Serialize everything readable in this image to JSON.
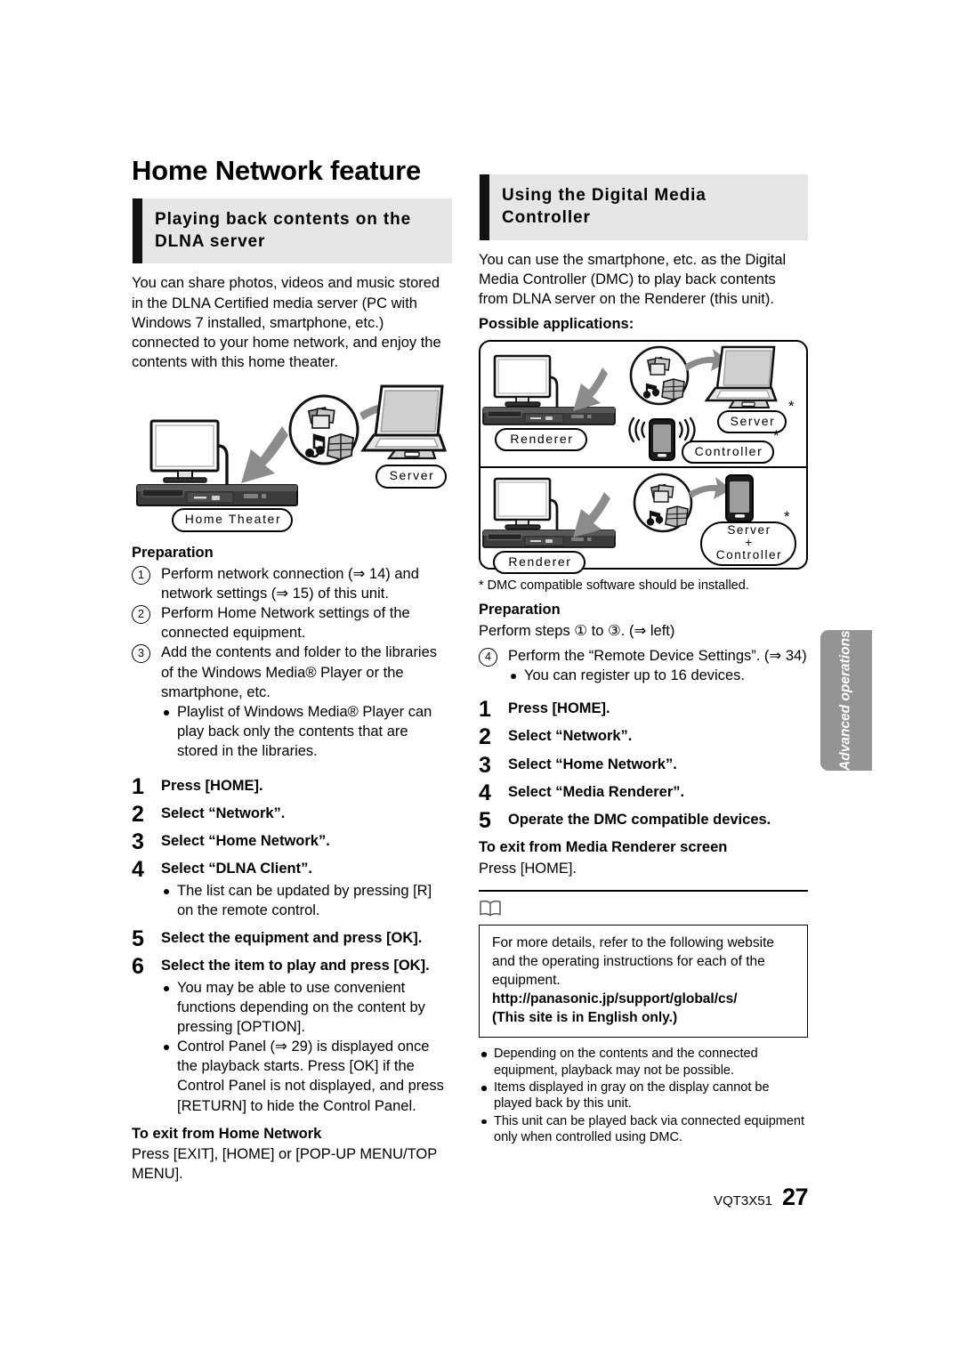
{
  "page": {
    "title": "Home Network feature",
    "footer_code": "VQT3X51",
    "footer_page": "27",
    "side_tab": "Advanced operations"
  },
  "left_column": {
    "section_title": "Playing back contents on the DLNA server",
    "intro": "You can share photos, videos and music stored in the DLNA Certified media server (PC with Windows 7 installed, smartphone, etc.) connected to your home network, and enjoy the contents with this home theater.",
    "figure": {
      "label_home_theater": "Home Theater",
      "label_server": "Server"
    },
    "preparation_heading": "Preparation",
    "preparation_items": [
      {
        "num": "1",
        "text": "Perform network connection (⇒ 14) and network settings (⇒ 15) of this unit."
      },
      {
        "num": "2",
        "text": "Perform Home Network settings of the connected equipment."
      },
      {
        "num": "3",
        "text": "Add the contents and folder to the libraries of the Windows Media® Player or the smartphone, etc."
      }
    ],
    "preparation_subnote": "Playlist of Windows Media® Player can play back only the contents that are stored in the libraries.",
    "steps": [
      {
        "num": "1",
        "text": "Press [HOME]."
      },
      {
        "num": "2",
        "text": "Select “Network”."
      },
      {
        "num": "3",
        "text": "Select “Home Network”."
      },
      {
        "num": "4",
        "text": "Select “DLNA Client”."
      },
      {
        "num": "5",
        "text": "Select the equipment and press [OK]."
      },
      {
        "num": "6",
        "text": "Select the item to play and press [OK]."
      }
    ],
    "step4_note": "The list can be updated by pressing [R] on the remote control.",
    "step6_notes": [
      "You may be able to use convenient functions depending on the content by pressing [OPTION].",
      "Control Panel (⇒ 29) is displayed once the playback starts. Press [OK] if the Control Panel is not displayed, and press [RETURN] to hide the Control Panel."
    ],
    "exit_heading": "To exit from Home Network",
    "exit_text": "Press [EXIT], [HOME] or [POP-UP MENU/TOP MENU]."
  },
  "right_column": {
    "section_title": "Using the Digital Media Controller",
    "intro": "You can use the smartphone, etc. as the Digital Media Controller (DMC) to play back contents from DLNA server on the Renderer (this unit).",
    "applications_heading": "Possible applications:",
    "figure": {
      "renderer_top": "Renderer",
      "renderer_bottom": "Renderer",
      "server": "Server",
      "controller": "Controller",
      "server_controller_line1": "Server",
      "server_controller_plus": "+",
      "server_controller_line2": "Controller",
      "star": "*"
    },
    "footnote": "*  DMC compatible software should be installed.",
    "preparation_heading": "Preparation",
    "preparation_lead": "Perform steps ① to ③. (⇒ left)",
    "preparation_items": [
      {
        "num": "4",
        "text": "Perform the “Remote Device Settings”. (⇒ 34)"
      }
    ],
    "preparation_subnote": "You can register up to 16 devices.",
    "steps": [
      {
        "num": "1",
        "text": "Press [HOME]."
      },
      {
        "num": "2",
        "text": "Select “Network”."
      },
      {
        "num": "3",
        "text": "Select “Home Network”."
      },
      {
        "num": "4",
        "text": "Select “Media Renderer”."
      },
      {
        "num": "5",
        "text": "Operate the DMC compatible devices."
      }
    ],
    "exit_heading": "To exit from Media Renderer screen",
    "exit_text": "Press [HOME].",
    "note_box": {
      "line1": "For more details, refer to the following website and the operating instructions for each of the equipment.",
      "url": "http://panasonic.jp/support/global/cs/",
      "line3": "(This site is in English only.)"
    },
    "bottom_notes": [
      "Depending on the contents and the connected equipment, playback may not be possible.",
      "Items displayed in gray on the display cannot be played back by this unit.",
      "This unit can be played back via connected equipment only when controlled using DMC."
    ]
  },
  "colors": {
    "section_header_bg": "#e6e6e6",
    "section_header_bar": "#121212",
    "side_tab_bg": "#949494",
    "text": "#000000"
  }
}
